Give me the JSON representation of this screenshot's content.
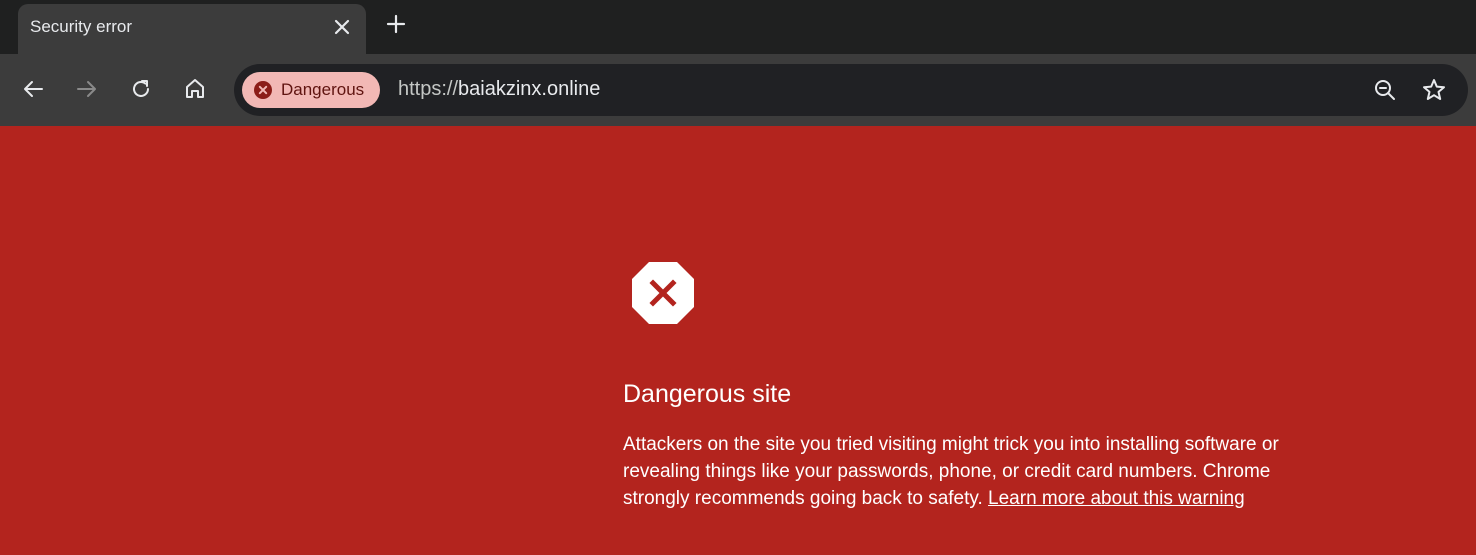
{
  "tab": {
    "title": "Security error"
  },
  "toolbar": {
    "security_chip": "Dangerous",
    "url_scheme": "https://",
    "url_host": "baiakzinx.online"
  },
  "page": {
    "heading": "Dangerous site",
    "body": "Attackers on the site you tried visiting might trick you into installing software or revealing things like your passwords, phone, or credit card numbers. Chrome strongly recommends going back to safety. ",
    "learn_more": "Learn more about this warning"
  },
  "icons": [
    "close-icon",
    "plus-icon",
    "back-icon",
    "forward-icon",
    "reload-icon",
    "home-icon",
    "danger-icon",
    "zoom-icon",
    "star-icon",
    "warning-octagon-icon"
  ],
  "colors": {
    "page_background": "#b3241e",
    "chip_background": "#f2b8b5",
    "chip_text": "#601410"
  }
}
